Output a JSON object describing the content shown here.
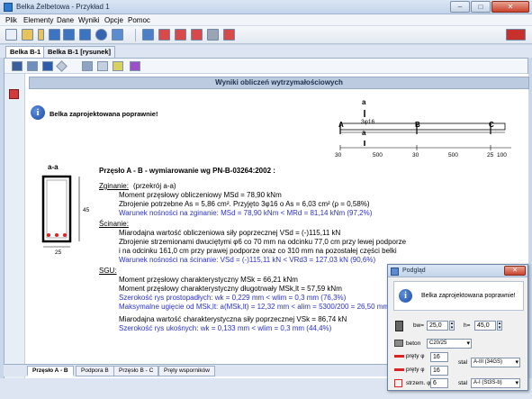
{
  "window": {
    "title": "Belka Żelbetowa - Przykład 1",
    "buttons": [
      "–",
      "□",
      "✕"
    ]
  },
  "menu": [
    "Plik",
    "Elementy",
    "Dane",
    "Wyniki",
    "Opcje",
    "Pomoc"
  ],
  "tabs": [
    "Belka B-1",
    "Belka B-1 [rysunek]"
  ],
  "header": "Wyniki obliczeń wytrzymałościowych",
  "status_message": "Belka zaprojektowana poprawnie!",
  "beam_diagram": {
    "section_top": "a",
    "section_bottom": "a",
    "supports": [
      "A",
      "B",
      "C"
    ],
    "bar_label": "3φ16",
    "dims": [
      "30",
      "500",
      "30",
      "500",
      "25",
      "100"
    ]
  },
  "section": {
    "title": "a-a",
    "height_label": "45",
    "width_label": "25"
  },
  "span_title": "Przęsło A - B - wymiarowanie wg PN-B-03264:2002 :",
  "bending": {
    "label": "Zginanie:",
    "note": "(przekrój a-a)",
    "lines": [
      "Moment przęsłowy obliczeniowy   MSd = 78,90 kNm",
      "Zbrojenie potrzebne As = 5,86 cm². Przyjęto 3φ16 o As = 6,03 cm²   (ρ = 0,58%)"
    ],
    "check": "Warunek nośności na zginanie:        MSd = 78,90 kNm  <  MRd = 81,14 kNm     (97,2%)"
  },
  "shear": {
    "label": "Ścinanie:",
    "lines": [
      "Miarodajna wartość obliczeniowa siły poprzecznej VSd = (-)115,11 kN",
      "Zbrojenie strzemionami dwuciętymi φ6 co 70 mm na odcinku 77,0 cm przy lewej podporze",
      "i na odcinku 161,0 cm przy prawej podporze oraz co 310 mm na pozostałej części belki"
    ],
    "check": "Warunek nośności na ścinanie:        VSd = (-)115,11 kN  <  VRd3 = 127,03 kN     (90,6%)"
  },
  "sls": {
    "label": "SGU:",
    "lines": [
      "Moment przęsłowy charakterystyczny   MSk = 66,21 kNm",
      "Moment przęsłowy charakterystyczny długotrwały   MSk,lt = 57,59 kNm"
    ],
    "checks": [
      "Szerokość rys prostopadłych:    wk = 0,229 mm  <  wlim = 0,3 mm      (76,3%)",
      "Maksymalne ugięcie od MSk,lt:    a(MSk,lt) = 12,32 mm  <  alim = 5300/200 = 26,50 mm"
    ],
    "line3": "Miarodajna wartość charakterystyczna siły poprzecznej VSk = 86,74 kN",
    "check3": "Szerokość rys ukośnych:    wk = 0,133 mm  <  wlim = 0,3 mm     (44,4%)"
  },
  "bottom_tabs": [
    "Przęsło A - B",
    "Podpora B",
    "Przęsło B - C",
    "Pręty wsporników"
  ],
  "dialog": {
    "title": "Podgląd",
    "message": "Belka zaprojektowana poprawnie!",
    "bw_label": "bw=",
    "bw_value": "25,0",
    "h_label": "h=",
    "h_value": "45,0",
    "concrete_label": "beton",
    "concrete_value": "C20/25",
    "bar_rows": [
      {
        "label": "pręty φ",
        "value": "16",
        "steel_label": "stal",
        "steel": "A-III (34GS)"
      },
      {
        "label": "pręty φ",
        "value": "16",
        "steel_label": "",
        "steel": ""
      },
      {
        "label": "strzem. φ",
        "value": "6",
        "steel_label": "stal",
        "steel": "A-I (St3S-b)"
      }
    ]
  },
  "colors": {
    "accent": "#2a32c8",
    "header_bg": "#bccbe0"
  }
}
